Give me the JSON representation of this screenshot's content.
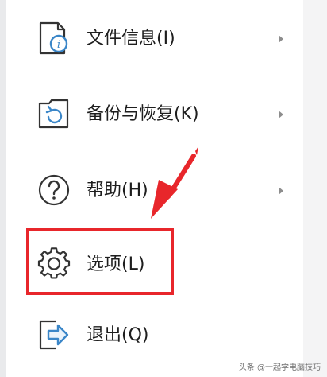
{
  "menu": {
    "items": [
      {
        "label": "文件信息(I)",
        "icon": "file-info-icon",
        "has_submenu": true
      },
      {
        "label": "备份与恢复(K)",
        "icon": "backup-restore-icon",
        "has_submenu": true
      },
      {
        "label": "帮助(H)",
        "icon": "help-icon",
        "has_submenu": true
      },
      {
        "label": "选项(L)",
        "icon": "gear-icon",
        "has_submenu": false,
        "highlighted": true
      },
      {
        "label": "退出(Q)",
        "icon": "exit-icon",
        "has_submenu": false
      }
    ]
  },
  "annotation": {
    "highlight_color": "#e8262b"
  },
  "watermark": {
    "text": "头条 @一起学电脑技巧"
  }
}
